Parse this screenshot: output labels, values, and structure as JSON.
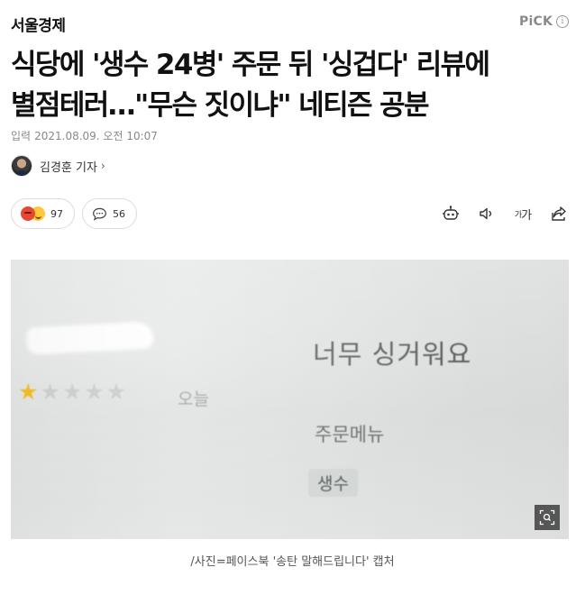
{
  "press": {
    "name": "서울경제"
  },
  "pick": {
    "label": "PiCK",
    "info_icon": "info-icon"
  },
  "article": {
    "headline_line1": "식당에 '생수 24병' 주문 뒤 '싱겁다' 리뷰에",
    "headline_line2": "별점테러…\"무슨 짓이냐\" 네티즌 공분",
    "date_label": "입력",
    "date_value": "2021.08.09. 오전 10:07",
    "reporter": "김경훈 기자",
    "reporter_chevron": "›"
  },
  "actions": {
    "reaction_count": "97",
    "comment_count": "56",
    "reaction_icons": [
      "angry-face-icon",
      "smile-face-icon"
    ],
    "comment_icon": "speech-bubble-icon"
  },
  "tools": {
    "icons": [
      "robot-summary-icon",
      "speaker-icon",
      "font-size-icon",
      "share-icon"
    ],
    "font_small": "가",
    "font_large": "가"
  },
  "photo": {
    "review_text": "너무 싱거워요",
    "stars_rating": 1,
    "stars_total": 5,
    "date_text": "오늘",
    "menu_label": "주문메뉴",
    "menu_item": "생수",
    "zoom_icon": "zoom-icon"
  },
  "caption": "/사진=페이스북 '송탄 말해드립니다' 캡처",
  "colors": {
    "star_active": "#f2b400",
    "star_inactive": "#c6c9c8",
    "angry": "#e8482f",
    "smile": "#ffc83d"
  }
}
